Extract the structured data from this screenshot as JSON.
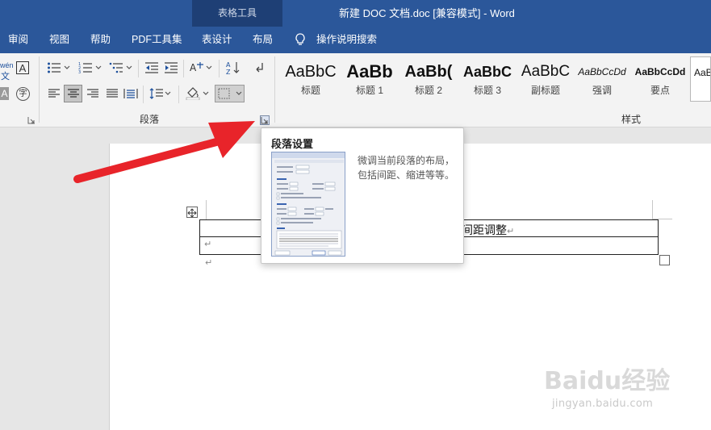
{
  "window": {
    "contextual_tab_group": "表格工具",
    "title": "新建 DOC 文档.doc [兼容模式]  -  Word"
  },
  "menu": {
    "items": [
      "审阅",
      "视图",
      "帮助",
      "PDF工具集",
      "表设计",
      "布局"
    ],
    "tell_me": "操作说明搜索"
  },
  "ribbon": {
    "font_group_fragment": "wén",
    "font_group_char": "文",
    "char_border_glyph": "A",
    "circled_char_glyph": "字",
    "paragraph_label": "段落",
    "styles_label": "样式",
    "styles": [
      {
        "sample": "AaBbC",
        "name": "标题"
      },
      {
        "sample": "AaBb",
        "name": "标题 1"
      },
      {
        "sample": "AaBb(",
        "name": "标题 2"
      },
      {
        "sample": "AaBbC",
        "name": "标题 3"
      },
      {
        "sample": "AaBbC",
        "name": "副标题"
      },
      {
        "sample": "AaBbCcDd",
        "name": "强调"
      },
      {
        "sample": "AaBbCcDd",
        "name": "要点"
      },
      {
        "sample": "AaB",
        "name": ""
      }
    ]
  },
  "tooltip": {
    "title": "段落设置",
    "description": "微调当前段落的布局，包括间距、缩进等等。"
  },
  "document": {
    "cell_text": "间距调整",
    "paragraph_mark": "↵"
  },
  "watermark": {
    "brand": "Baidu经验",
    "url": "jingyan.baidu.com"
  },
  "colors": {
    "title_bar": "#2b579a",
    "contextual_tab": "#1e3f75",
    "annotation_arrow": "#e8242a"
  }
}
